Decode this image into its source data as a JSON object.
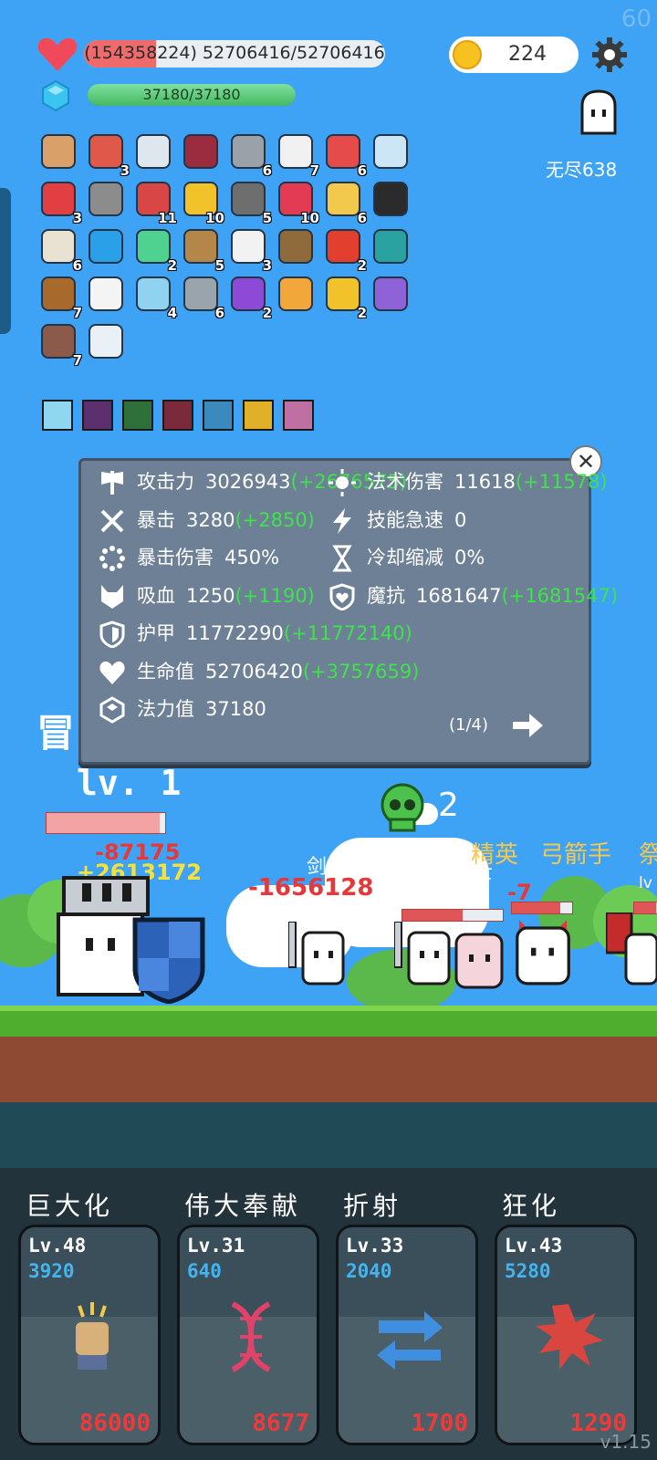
{
  "hud": {
    "fps": "60",
    "hp_text": "(154358224) 52706416/52706416",
    "hp_fraction": 0.24,
    "mp_text": "37180/37180",
    "mp_fraction": 1.0,
    "coins": "224",
    "mode_label": "无尽638"
  },
  "items": [
    {
      "icon": "donut-icon",
      "count": "",
      "color": "#d9a06a"
    },
    {
      "icon": "watermelon-icon",
      "count": "3",
      "color": "#e0584a"
    },
    {
      "icon": "sword-icon",
      "count": "",
      "color": "#dfe7ee"
    },
    {
      "icon": "jam-jar-icon",
      "count": "",
      "color": "#9b2b3e"
    },
    {
      "icon": "spiked-mace-icon",
      "count": "6",
      "color": "#9aa1a8"
    },
    {
      "icon": "dice-icon",
      "count": "7",
      "color": "#f1f1f1"
    },
    {
      "icon": "pill-icon",
      "count": "6",
      "color": "#e54b4b"
    },
    {
      "icon": "crosshair-icon",
      "count": "",
      "color": "#cde6f5"
    },
    {
      "icon": "strawberry-icon",
      "count": "3",
      "color": "#e23f43"
    },
    {
      "icon": "knight-helmet-icon",
      "count": "",
      "color": "#8c8c8c"
    },
    {
      "icon": "red-shield-icon",
      "count": "11",
      "color": "#d94646"
    },
    {
      "icon": "sunflower-icon",
      "count": "10",
      "color": "#f2c22a"
    },
    {
      "icon": "hook-icon",
      "count": "5",
      "color": "#6e6e6e"
    },
    {
      "icon": "hearts-icon",
      "count": "10",
      "color": "#e23b53"
    },
    {
      "icon": "ring-icon",
      "count": "6",
      "color": "#f2c94c"
    },
    {
      "icon": "black-cat-icon",
      "count": "",
      "color": "#2b2b2b"
    },
    {
      "icon": "coconut-icon",
      "count": "6",
      "color": "#e9e2d2"
    },
    {
      "icon": "blue-gem-icon",
      "count": "",
      "color": "#2aa0e8"
    },
    {
      "icon": "green-ghost-icon",
      "count": "2",
      "color": "#4fd18f"
    },
    {
      "icon": "bow-icon",
      "count": "5",
      "color": "#b5864a"
    },
    {
      "icon": "envelope-icon",
      "count": "3",
      "color": "#f2f2f2"
    },
    {
      "icon": "meteor-icon",
      "count": "",
      "color": "#8f6a3a"
    },
    {
      "icon": "apple-icon",
      "count": "2",
      "color": "#e23f2f"
    },
    {
      "icon": "speech-bubble-icon",
      "count": "",
      "color": "#2aa2a2"
    },
    {
      "icon": "drink-cup-icon",
      "count": "7",
      "color": "#a8692d"
    },
    {
      "icon": "white-ghost-icon",
      "count": "",
      "color": "#f4f4f4"
    },
    {
      "icon": "potion-flask-icon",
      "count": "4",
      "color": "#8fd3f0"
    },
    {
      "icon": "battle-axe-icon",
      "count": "6",
      "color": "#9aa4ad"
    },
    {
      "icon": "crystal-ball-icon",
      "count": "2",
      "color": "#8d4ad6"
    },
    {
      "icon": "spellbook-icon",
      "count": "",
      "color": "#f2a73a"
    },
    {
      "icon": "magic-wand-icon",
      "count": "2",
      "color": "#f2c22a"
    },
    {
      "icon": "purple-chest-icon",
      "count": "",
      "color": "#8f62d8"
    },
    {
      "icon": "armor-icon",
      "count": "7",
      "color": "#8b5a4a"
    },
    {
      "icon": "lightbulb-icon",
      "count": "",
      "color": "#e9f1f7"
    }
  ],
  "runes": [
    {
      "icon": "light-rune-icon",
      "color": "#8fd6f0"
    },
    {
      "icon": "demon-rune-icon",
      "color": "#5c2f6f"
    },
    {
      "icon": "sprout-rune-icon",
      "color": "#2f6f3a"
    },
    {
      "icon": "blood-rune-icon",
      "color": "#7a2a3a"
    },
    {
      "icon": "storm-rune-icon",
      "color": "#3a8ac0"
    },
    {
      "icon": "skull-rune-icon",
      "color": "#e0b028"
    },
    {
      "icon": "pink-rune-icon",
      "color": "#c06fa2"
    }
  ],
  "stats": {
    "left": [
      {
        "icon": "axe-icon",
        "label": "攻击力",
        "value": "3026943",
        "bonus": "(+2676575)"
      },
      {
        "icon": "crit-icon",
        "label": "暴击",
        "value": "3280",
        "bonus": "(+2850)"
      },
      {
        "icon": "crit-damage-icon",
        "label": "暴击伤害",
        "value": "450%",
        "bonus": ""
      },
      {
        "icon": "lifesteal-icon",
        "label": "吸血",
        "value": "1250",
        "bonus": "(+1190)"
      },
      {
        "icon": "armor-shield-icon",
        "label": "护甲",
        "value": "11772290",
        "bonus": "(+11772140)"
      },
      {
        "icon": "heart-icon",
        "label": "生命值",
        "value": "52706420",
        "bonus": "(+3757659)"
      },
      {
        "icon": "mana-gem-icon",
        "label": "法力值",
        "value": "37180",
        "bonus": ""
      }
    ],
    "right": [
      {
        "icon": "sun-icon",
        "label": "法术伤害",
        "value": "11618",
        "bonus": "(+11578)"
      },
      {
        "icon": "lightning-icon",
        "label": "技能急速",
        "value": "0",
        "bonus": ""
      },
      {
        "icon": "hourglass-icon",
        "label": "冷却缩减",
        "value": "0%",
        "bonus": ""
      },
      {
        "icon": "magic-shield-icon",
        "label": "魔抗",
        "value": "1681647",
        "bonus": "(+1681547)"
      }
    ],
    "page": "(1/4)"
  },
  "battle": {
    "stage_partial": "冒",
    "hero_level": "lv. 1",
    "kill_count": "2",
    "enemy_labels": [
      "精英",
      "弓箭手",
      "祭"
    ],
    "unit_names": [
      "剑",
      "剑士剑士"
    ],
    "unit_levels": [
      "lv. 1 lv. 1",
      "lv"
    ],
    "damage_numbers": [
      "-87175",
      "+2613172",
      "-1656128",
      "-7"
    ]
  },
  "skills": [
    {
      "name": "巨大化",
      "level": "Lv.48",
      "points": "3920",
      "cost": "86000",
      "icon": "fist-icon",
      "color": "#d7b07a"
    },
    {
      "name": "伟大奉献",
      "level": "Lv.31",
      "points": "640",
      "cost": "8677",
      "icon": "dna-icon",
      "color": "#e0436a"
    },
    {
      "name": "折射",
      "level": "Lv.33",
      "points": "2040",
      "cost": "1700",
      "icon": "swap-arrows-icon",
      "color": "#3f8ee0"
    },
    {
      "name": "狂化",
      "level": "Lv.43",
      "points": "5280",
      "cost": "1290",
      "icon": "rage-splat-icon",
      "color": "#d9463f"
    }
  ],
  "version": "v1.15"
}
